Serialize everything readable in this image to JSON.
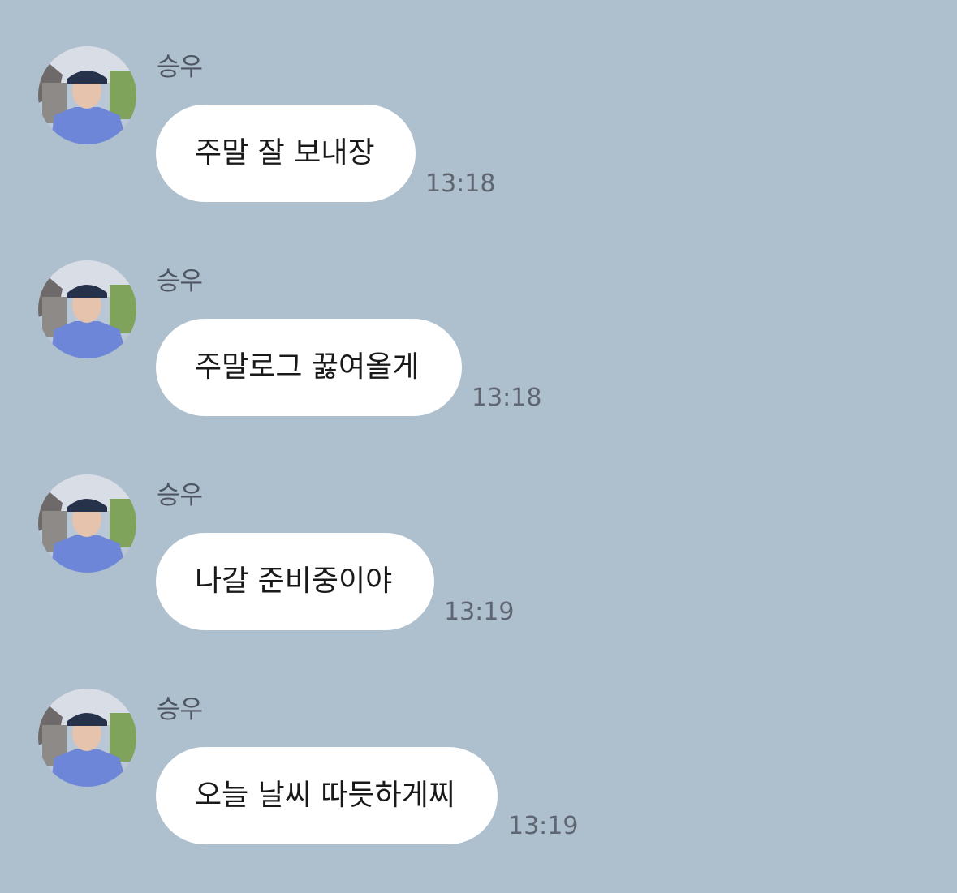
{
  "theme": {
    "background": "#aebfce",
    "bubble": "#ffffff",
    "text": "#191919",
    "sender_color": "#4e5561",
    "time_color": "#5f6672"
  },
  "messages": [
    {
      "sender": "승우",
      "text": "주말 잘 보내장",
      "time": "13:18",
      "avatar_icon": "profile-photo"
    },
    {
      "sender": "승우",
      "text": "주말로그 꿇여올게",
      "time": "13:18",
      "avatar_icon": "profile-photo"
    },
    {
      "sender": "승우",
      "text": "나갈 준비중이야",
      "time": "13:19",
      "avatar_icon": "profile-photo"
    },
    {
      "sender": "승우",
      "text": "오늘 날씨 따듯하게찌",
      "time": "13:19",
      "avatar_icon": "profile-photo"
    }
  ]
}
